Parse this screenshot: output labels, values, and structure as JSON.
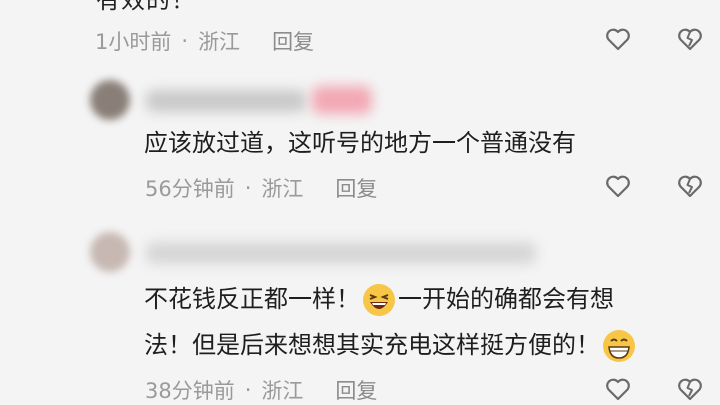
{
  "comment1": {
    "cut_text": "有效的！",
    "time": "1小时前",
    "location": "浙江",
    "reply_label": "回复"
  },
  "comment2": {
    "content": "应该放过道，这听号的地方一个普通没有",
    "time": "56分钟前",
    "location": "浙江",
    "reply_label": "回复"
  },
  "comment3": {
    "line1_a": "不花钱反正都一样！",
    "line1_b": "一开始的确都会有想",
    "line2": "法！但是后来想想其实充电这样挺方便的！",
    "time": "38分钟前",
    "location": "浙江",
    "reply_label": "回复"
  },
  "separator": "·",
  "icons": {
    "like": "heart-outline-icon",
    "dislike": "broken-heart-icon",
    "emoji_laugh": "laughing-emoji-icon",
    "emoji_grin": "grinning-emoji-icon"
  },
  "colors": {
    "background": "#f4f4f4",
    "text": "#1e1e1e",
    "meta": "#9a9a9a",
    "icon": "#6a6a6a"
  }
}
